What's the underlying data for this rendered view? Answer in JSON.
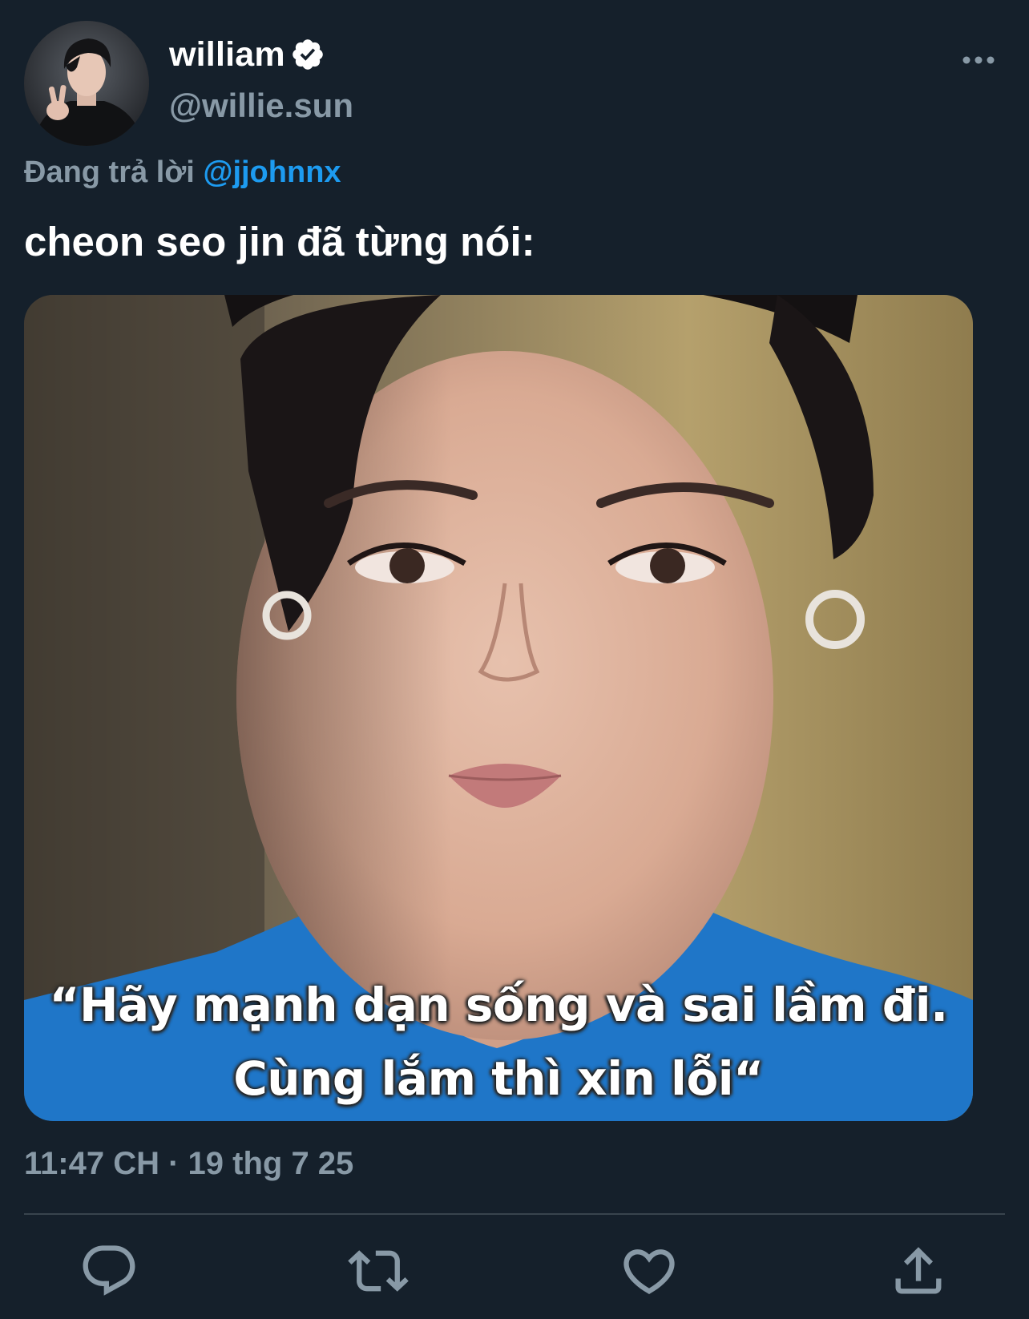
{
  "tweet": {
    "author": {
      "display_name": "william",
      "handle": "@willie.sun",
      "verified": true
    },
    "reply_to": {
      "prefix": "Đang trả lời",
      "mention": "@jjohnnx"
    },
    "text": "cheon seo jin đã từng nói:",
    "media": {
      "caption_line_1": "“Hãy mạnh dạn sống và sai lầm đi.",
      "caption_line_2": "Cùng lắm thì xin lỗi“"
    },
    "timestamp": "11:47 CH · 19 thg 7 25"
  },
  "icons": {
    "verified": "verified-badge-icon",
    "more": "more-options-icon",
    "reply": "reply-icon",
    "retweet": "retweet-icon",
    "like": "heart-icon",
    "share": "share-icon"
  },
  "colors": {
    "background": "#15202b",
    "secondary_text": "#8899a6",
    "accent": "#1d9bf0",
    "divider": "#38444d"
  }
}
